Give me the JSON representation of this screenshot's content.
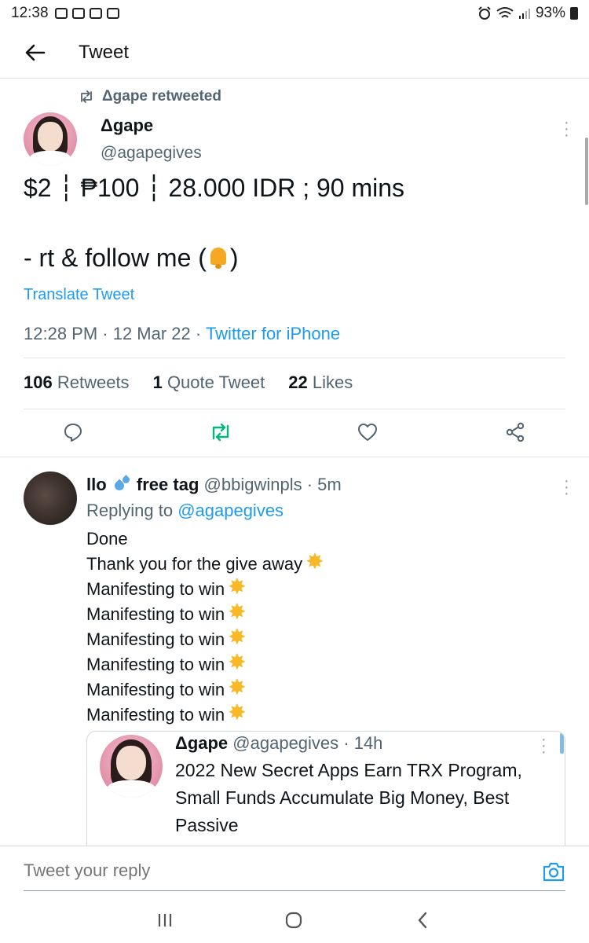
{
  "status_bar": {
    "time": "12:38",
    "battery": "93%"
  },
  "header": {
    "title": "Tweet"
  },
  "main_tweet": {
    "retweeted_by": "Δgape retweeted",
    "author_name": "Δgape",
    "author_handle": "@agapegives",
    "text_line1": "$2 ┆ ₱100 ┆ 28.000 IDR ; 90 mins",
    "text_line2_prefix": "- rt & follow me (",
    "text_line2_suffix": ")",
    "translate": "Translate Tweet",
    "time": "12:28 PM · 12 Mar 22 · ",
    "source": "Twitter for iPhone",
    "stats": {
      "retweets_count": "106",
      "retweets_label": "Retweets",
      "quotes_count": "1",
      "quotes_label": "Quote Tweet",
      "likes_count": "22",
      "likes_label": "Likes"
    }
  },
  "reply": {
    "name_prefix": "llo",
    "name_suffix": "free tag",
    "handle_time": "@bbigwinpls · 5m",
    "replying_prefix": "Replying to ",
    "replying_to": "@agapegives",
    "lines": [
      "Done",
      "Thank you for the give away",
      "Manifesting to win",
      "Manifesting to win",
      "Manifesting to win",
      "Manifesting to win",
      "Manifesting to win",
      "Manifesting to win"
    ],
    "quoted": {
      "name": "Δgape",
      "handle_time": "@agapegives · 14h",
      "text": "2022 New Secret Apps Earn TRX Program, Small Funds Accumulate Big Money, Best Passive"
    }
  },
  "reply_box": {
    "placeholder": "Tweet your reply"
  },
  "colors": {
    "accent": "#1d9bf0",
    "retweet_green": "#00ba7c",
    "muted": "#536471"
  }
}
